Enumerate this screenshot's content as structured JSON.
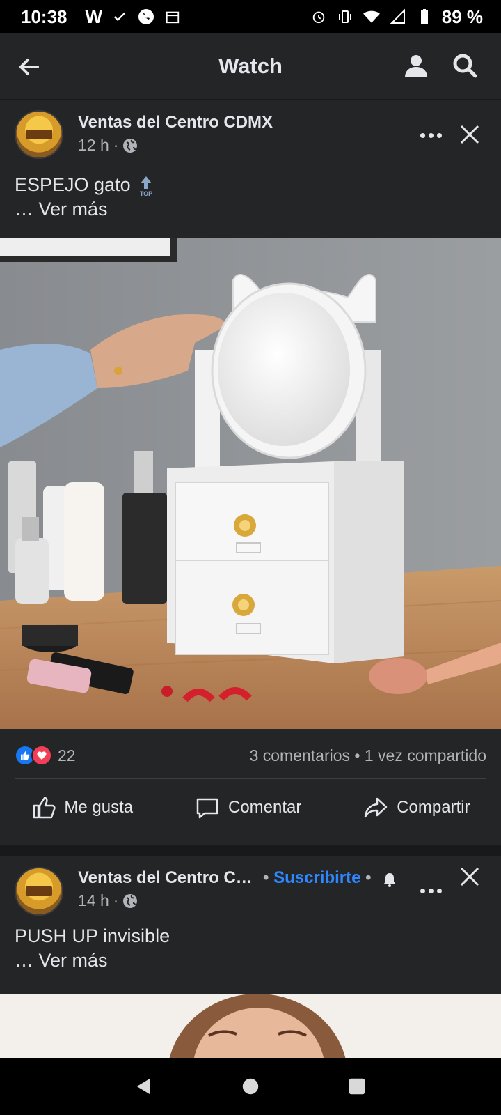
{
  "status_bar": {
    "time": "10:38",
    "carrier_letter": "W",
    "battery": "89 %"
  },
  "app_bar": {
    "title": "Watch"
  },
  "post1": {
    "page_name": "Ventas del Centro CDMX",
    "time": "12 h",
    "text": "ESPEJO gato",
    "see_more": "… Ver más",
    "reaction_count": "22",
    "engagement": "3 comentarios • 1 vez compartido",
    "actions": {
      "like": "Me gusta",
      "comment": "Comentar",
      "share": "Compartir"
    }
  },
  "post2": {
    "page_name": "Ventas del Centro C…",
    "subscribe": "Suscribirte",
    "time": "14 h",
    "text": "PUSH UP invisible",
    "see_more": "… Ver más"
  },
  "colors": {
    "background": "#242526",
    "separator": "#18191a",
    "text_primary": "#e4e6eb",
    "text_secondary": "#b0b3b8",
    "link_blue": "#2d88ff",
    "like_blue": "#1877f2",
    "love_red": "#f33e58"
  },
  "icons": [
    "back-arrow-icon",
    "user-icon",
    "search-icon",
    "more-icon",
    "close-icon",
    "globe-icon",
    "top-arrow-icon",
    "like-icon",
    "comment-icon",
    "share-icon",
    "bell-icon",
    "nav-back-icon",
    "nav-home-icon",
    "nav-recents-icon"
  ]
}
